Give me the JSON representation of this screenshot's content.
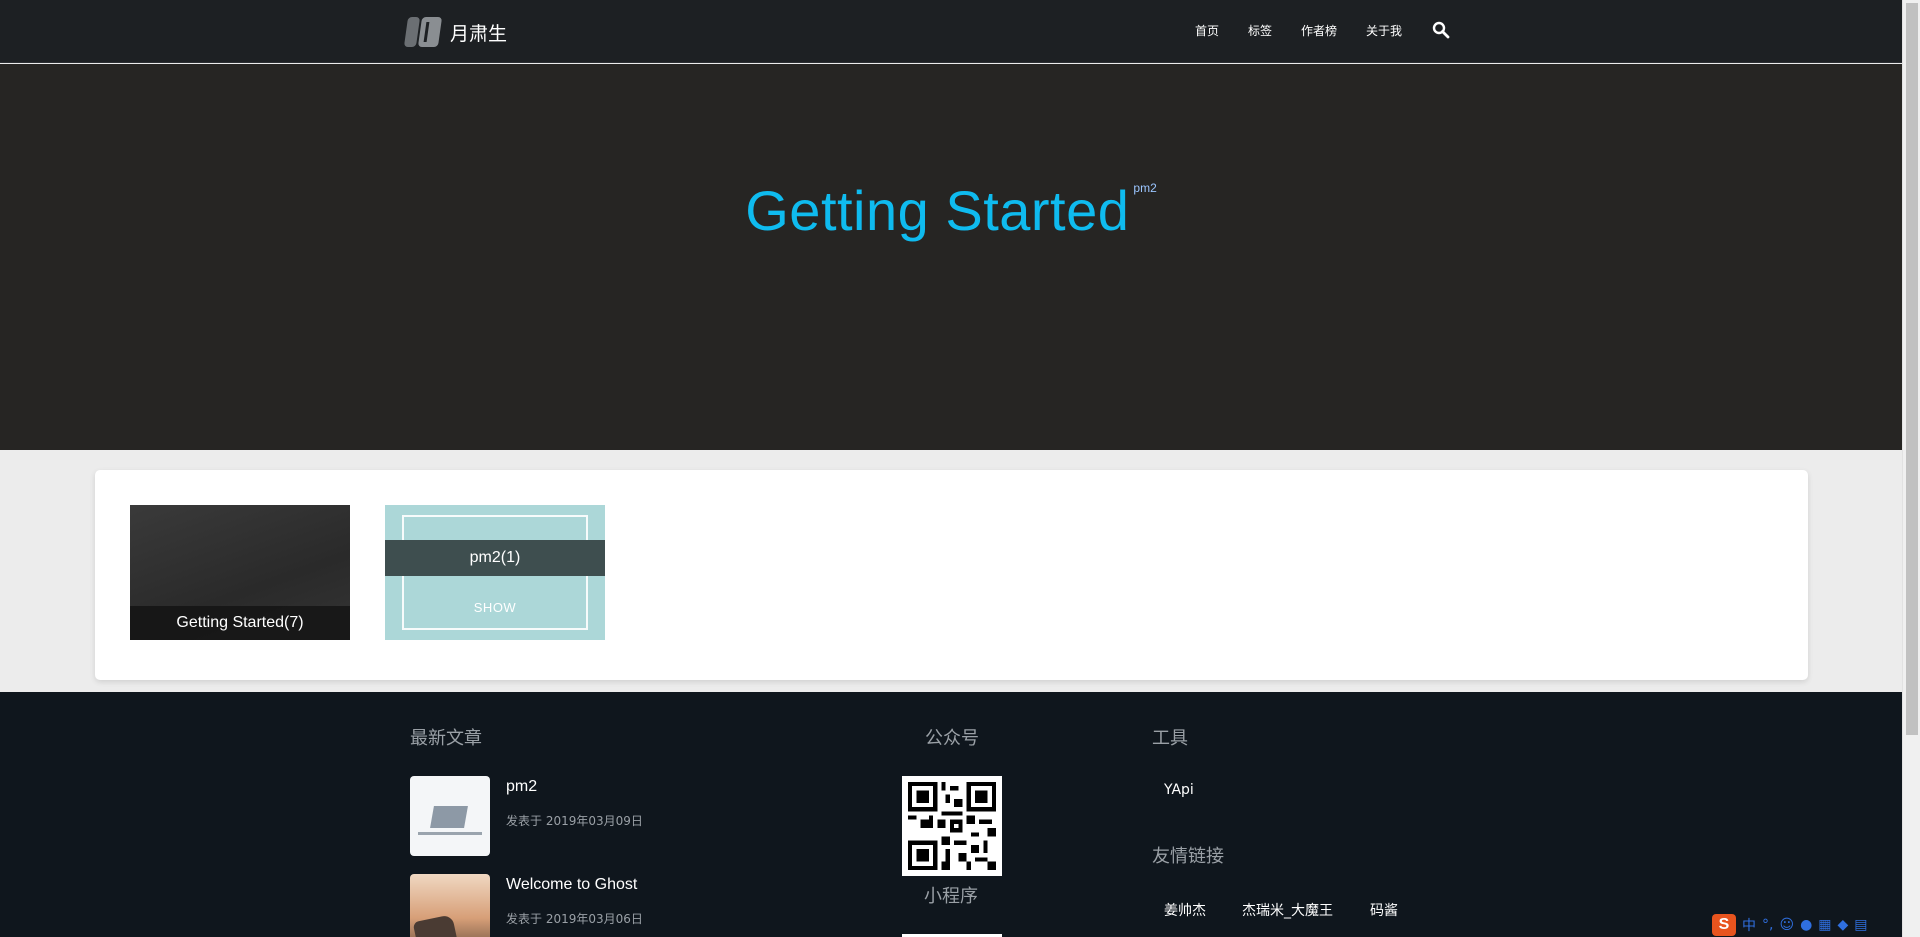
{
  "header": {
    "brand_name": "月肃生",
    "nav": [
      "首页",
      "标签",
      "作者榜",
      "关于我"
    ]
  },
  "hero": {
    "title": "Getting Started",
    "tag_superscript": "pm2"
  },
  "tags": [
    {
      "label": "Getting Started(7)"
    },
    {
      "label": "pm2(1)",
      "hover_action": "SHOW"
    }
  ],
  "footer": {
    "latest": {
      "title": "最新文章",
      "posts": [
        {
          "title": "pm2",
          "date": "发表于 2019年03月09日"
        },
        {
          "title": "Welcome to Ghost",
          "date": "发表于 2019年03月06日"
        }
      ]
    },
    "wechat": {
      "title": "公众号",
      "mini_program_label": "小程序"
    },
    "tools": {
      "title": "工具",
      "links": [
        "YApi"
      ]
    },
    "friends": {
      "title": "友情链接",
      "links": [
        "姜帅杰",
        "杰瑞米_大魔王",
        "码酱"
      ]
    }
  },
  "ime": {
    "logo": "S",
    "mode": "中",
    "punct": "°,"
  },
  "colors": {
    "nav_bg": "#1d2023",
    "hero_bg": "#262523",
    "hero_title": "#0fbbef",
    "footer_bg": "#0f161d",
    "tag_teal": "#acd7d8"
  }
}
